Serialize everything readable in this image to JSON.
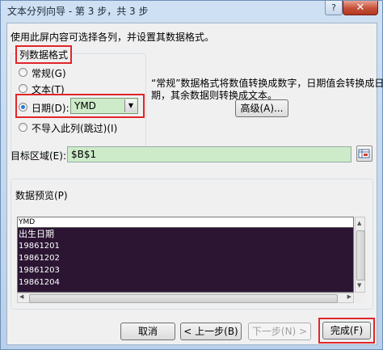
{
  "window": {
    "title": "文本分列向导 - 第 3 步，共 3 步",
    "help": "?",
    "close": "✕"
  },
  "intro": "使用此屏内容可选择各列，并设置其数据格式。",
  "column_format": {
    "group_label": "列数据格式",
    "options": [
      {
        "label": "常规(G)",
        "selected": false
      },
      {
        "label": "文本(T)",
        "selected": false
      },
      {
        "label": "日期(D):",
        "selected": true
      },
      {
        "label": "不导入此列(跳过)(I)",
        "selected": false
      }
    ],
    "date_format_value": "YMD"
  },
  "description": {
    "line1": "“常规”数据格式将数值转换成数字，日期值会转换成日",
    "line2": "期，其余数据则转换成文本。"
  },
  "advanced_button": "高级(A)...",
  "destination": {
    "label": "目标区域(E):",
    "value": "$B$1"
  },
  "preview": {
    "label": "数据预览(P)",
    "header": "YMD",
    "rows": [
      "出生日期",
      "19861201",
      "19861202",
      "19861203",
      "19861204"
    ]
  },
  "buttons": {
    "cancel": "取消",
    "back": "< 上一步(B)",
    "next": "下一步(N) >",
    "finish": "完成(F)"
  },
  "colors": {
    "highlight": "#e0262a",
    "field_green": "#cdebc9",
    "preview_bg": "#2b1533"
  }
}
